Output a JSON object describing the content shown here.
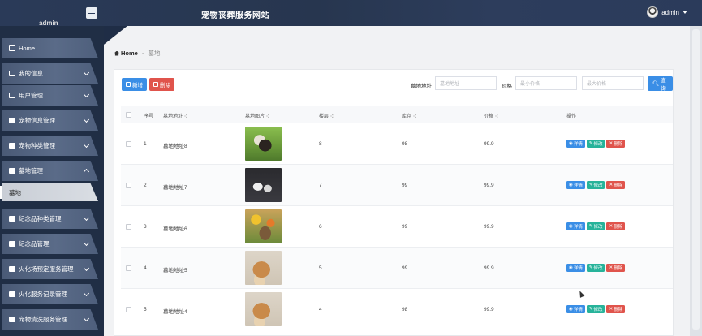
{
  "header": {
    "brand_user": "admin",
    "site_title": "宠物丧葬服务网站",
    "user_name": "admin"
  },
  "sidebar": {
    "items": [
      {
        "label": "Home",
        "icon": "home-icon",
        "expanded": false
      },
      {
        "label": "我的信息",
        "icon": "profile-icon",
        "expanded": false
      },
      {
        "label": "用户管理",
        "icon": "sliders-icon",
        "expanded": false
      },
      {
        "label": "宠物信息管理",
        "icon": "user-icon",
        "expanded": false
      },
      {
        "label": "宠物种类管理",
        "icon": "grid-icon",
        "expanded": false
      },
      {
        "label": "墓地管理",
        "icon": "grid-icon",
        "expanded": true
      },
      {
        "label": "墓地",
        "icon": "",
        "sub": true
      },
      {
        "label": "纪念品种类管理",
        "icon": "ticket-icon",
        "expanded": false
      },
      {
        "label": "纪念品管理",
        "icon": "grid-icon",
        "expanded": false
      },
      {
        "label": "火化场预定服务管理",
        "icon": "chart-icon",
        "expanded": false
      },
      {
        "label": "火化服务记录管理",
        "icon": "user-icon",
        "expanded": false
      },
      {
        "label": "宠物清洗服务管理",
        "icon": "trophy-icon",
        "expanded": false
      }
    ]
  },
  "breadcrumb": {
    "home": "Home",
    "separator": "-",
    "current": "墓地"
  },
  "toolbar": {
    "add_label": "新增",
    "delete_label": "删除",
    "address_label": "墓地地址",
    "address_placeholder": "墓地地址",
    "price_label": "价格",
    "min_price_placeholder": "最小价格",
    "max_price_placeholder": "最大价格",
    "search_label": "查询"
  },
  "table": {
    "columns": [
      "序号",
      "墓地地址",
      "墓地图片",
      "楼层",
      "库存",
      "价格",
      "操作"
    ],
    "rows": [
      {
        "index": "1",
        "address": "墓地地址8",
        "floor": "8",
        "stock": "98",
        "price": "99.9",
        "image": "cat-photo"
      },
      {
        "index": "2",
        "address": "墓地地址7",
        "floor": "7",
        "stock": "99",
        "price": "99.9",
        "image": "urn-photo"
      },
      {
        "index": "3",
        "address": "墓地地址6",
        "floor": "6",
        "stock": "99",
        "price": "99.9",
        "image": "flower-photo"
      },
      {
        "index": "4",
        "address": "墓地地址5",
        "floor": "5",
        "stock": "99",
        "price": "99.9",
        "image": "wood-photo"
      },
      {
        "index": "5",
        "address": "墓地地址4",
        "floor": "4",
        "stock": "98",
        "price": "99.9",
        "image": "wood-photo"
      }
    ],
    "actions": {
      "view": "详情",
      "edit": "修改",
      "delete": "删除"
    }
  },
  "colors": {
    "primary": "#3a8ee6",
    "danger": "#e0544c",
    "success": "#27b39a",
    "sidebar": "#202e45"
  }
}
